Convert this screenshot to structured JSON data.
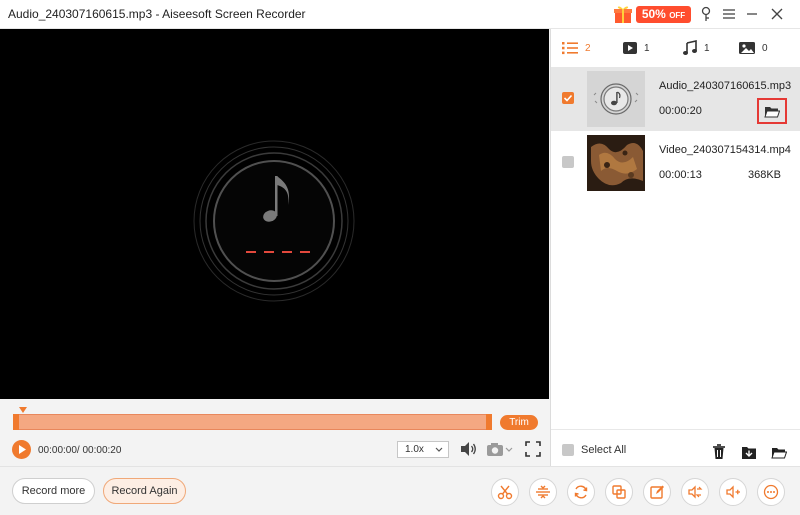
{
  "window": {
    "title": "Audio_240307160615.mp3  -  Aiseesoft Screen Recorder",
    "promo": {
      "percent": "50%",
      "suffix": "OFF"
    }
  },
  "tabs": [
    {
      "name": "list",
      "count": "2",
      "icon": "list-icon"
    },
    {
      "name": "video",
      "count": "1",
      "icon": "video-icon"
    },
    {
      "name": "audio",
      "count": "1",
      "icon": "music-note-icon"
    },
    {
      "name": "image",
      "count": "0",
      "icon": "image-icon"
    }
  ],
  "files": [
    {
      "name": "Audio_240307160615.mp3",
      "duration": "00:00:20",
      "size": "",
      "checked": true
    },
    {
      "name": "Video_240307154314.mp4",
      "duration": "00:00:13",
      "size": "368KB",
      "checked": false
    }
  ],
  "player": {
    "time": "00:00:00/ 00:00:20",
    "speed": "1.0x",
    "trim_label": "Trim"
  },
  "panel_footer": {
    "select_all": "Select All"
  },
  "bottom": {
    "record_more": "Record more",
    "record_again": "Record Again"
  },
  "colors": {
    "accent": "#f07a2e",
    "highlight": "#e53935",
    "waveform": "#f4a882"
  }
}
